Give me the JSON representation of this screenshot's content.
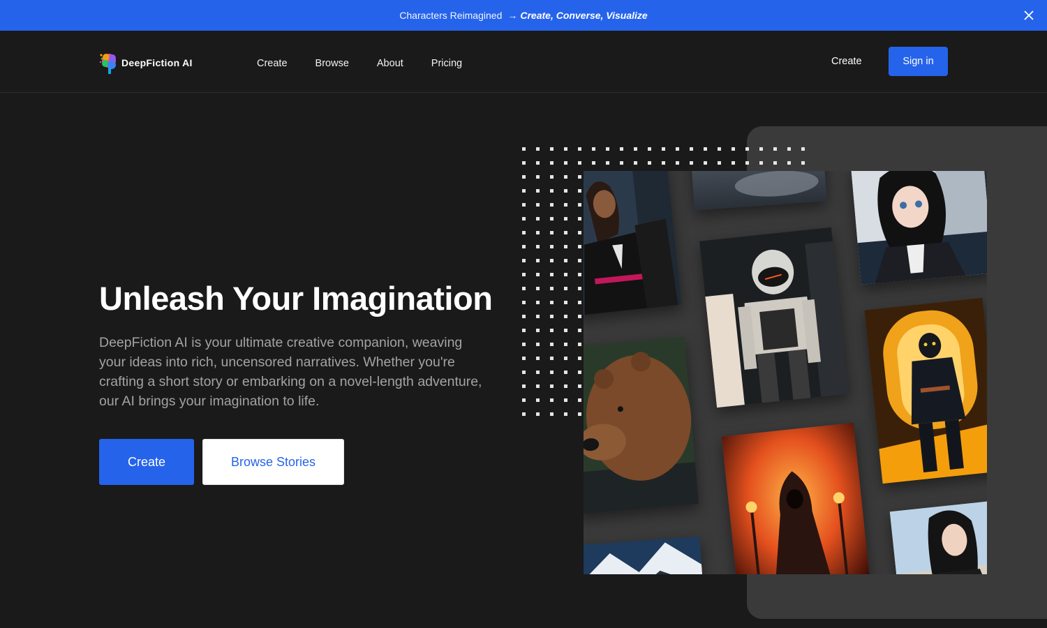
{
  "banner": {
    "text": "Characters Reimagined",
    "arrow": "→",
    "tagline": "Create, Converse, Visualize",
    "close_icon": "close-icon"
  },
  "nav": {
    "logo_icon": "brain-logo-icon",
    "logo_text": "DeepFiction AI",
    "links": [
      "Create",
      "Browse",
      "About",
      "Pricing"
    ],
    "create_label": "Create",
    "signin_label": "Sign in"
  },
  "hero": {
    "title": "Unleash Your Imagination",
    "description": "DeepFiction AI is your ultimate creative companion, weaving your ideas into rich, uncensored narratives. Whether you're crafting a short story or embarking on a novel-length adventure, our AI brings your imagination to life.",
    "create_label": "Create",
    "browse_label": "Browse Stories"
  },
  "gallery": {
    "images": [
      "woman-in-uniform",
      "cloudy-sky",
      "anime-girl",
      "armored-astronaut",
      "golden-knight",
      "brown-bear",
      "hooded-fire-mage",
      "snowy-mountains",
      "dark-haired-woman"
    ]
  },
  "colors": {
    "accent": "#2563eb",
    "background": "#1a1a1a",
    "panel": "#3a3a3a"
  }
}
